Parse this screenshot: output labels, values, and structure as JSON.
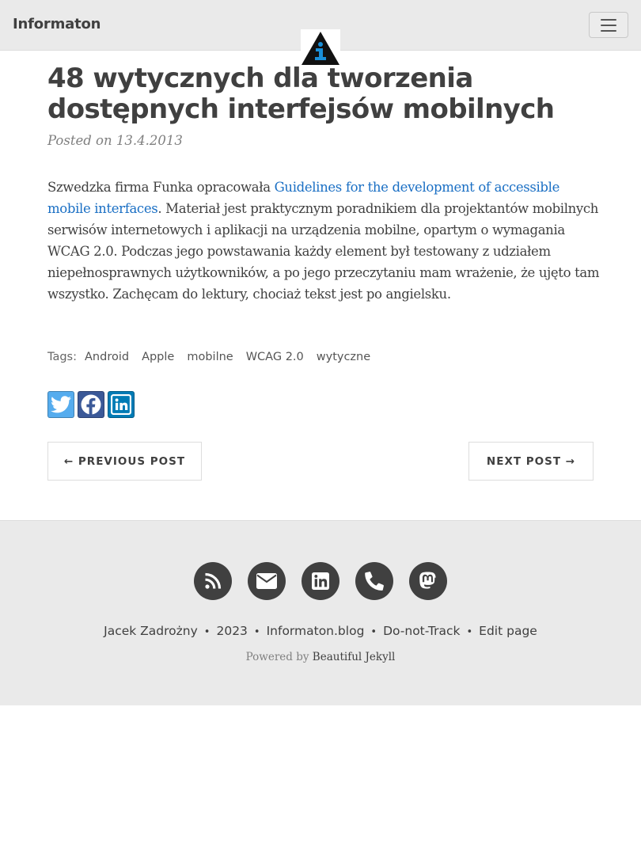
{
  "navbar": {
    "brand": "Informaton",
    "menu_toggle_icon": "hamburger-icon",
    "avatar_icon": "information-logo-icon",
    "colors": {
      "background": "#eaeaea",
      "logo_blue": "#1a8fd8"
    }
  },
  "post": {
    "title": "48 wytycznych dla tworzenia dostępnych interfejsów mobilnych",
    "meta": "Posted on 13.4.2013",
    "body_intro": "Szwedzka firma Funka opracowała ",
    "body_link": "Guidelines for the development of accessible mobile interfaces",
    "body_rest": ". Materiał jest praktycznym poradnikiem dla projektantów mobilnych serwisów internetowych i aplikacji na urządzenia mobilne, opartym o wymagania WCAG 2.0. Podczas jego powstawania każdy element był testowany z udziałem niepełnosprawnych użytkowników, a po jego przeczytaniu mam wrażenie, że ujęto tam wszystko. Zachęcam do lektury, chociaż tekst jest po angielsku.",
    "link_color": "#1a6fc4"
  },
  "tags": {
    "label": "Tags:",
    "items": [
      "Android",
      "Apple",
      "mobilne",
      "WCAG 2.0",
      "wytyczne"
    ]
  },
  "share": {
    "buttons": [
      {
        "icon": "twitter-icon",
        "color": "#55acee"
      },
      {
        "icon": "facebook-icon",
        "color": "#3b5998"
      },
      {
        "icon": "linkedin-icon",
        "color": "#007bb5"
      }
    ]
  },
  "pager": {
    "previous": "← PREVIOUS POST",
    "next": "NEXT POST →"
  },
  "footer": {
    "icons": [
      "rss-icon",
      "envelope-icon",
      "linkedin-icon",
      "phone-icon",
      "mastodon-icon"
    ],
    "links": [
      "Jacek Zadrożny",
      "2023",
      "Informaton.blog",
      "Do-not-Track",
      "Edit page"
    ],
    "separator": "•",
    "powered_prefix": "Powered by ",
    "powered_link": "Beautiful Jekyll",
    "colors": {
      "background": "#eaeaea",
      "icon_bg": "#404040"
    }
  }
}
